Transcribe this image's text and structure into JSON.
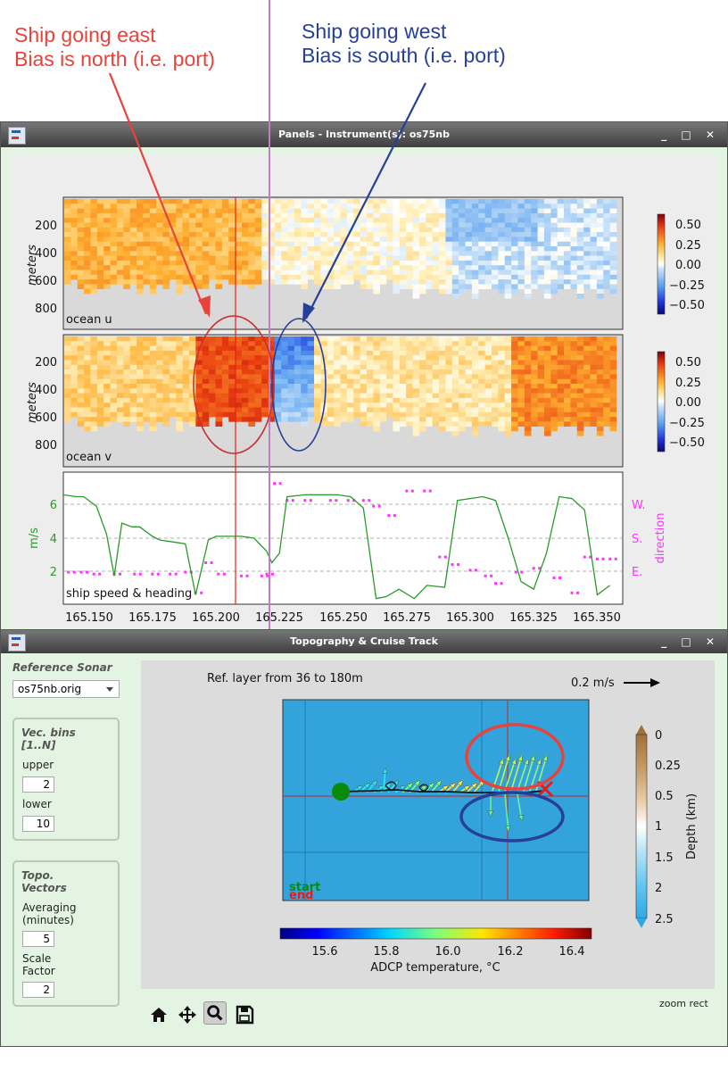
{
  "annotations": {
    "east_line1": "Ship going east",
    "east_line2": "Bias is north (i.e. port)",
    "west_line1": "Ship going west",
    "west_line2": "Bias is south (i.e. port)",
    "east_color": "#e8423a",
    "west_color": "#26409a"
  },
  "panels_window": {
    "title": "Panels - Instrument(s): os75nb",
    "buttons": [
      "_",
      "□",
      "✕"
    ]
  },
  "ocean_u": {
    "label": "ocean u",
    "ylabel": "meters",
    "yticks": [
      "200",
      "400",
      "600",
      "800"
    ],
    "cbar_ticks": [
      "0.50",
      "0.25",
      "0.00",
      "−0.25",
      "−0.50"
    ]
  },
  "ocean_v": {
    "label": "ocean v",
    "ylabel": "meters",
    "yticks": [
      "200",
      "400",
      "600",
      "800"
    ],
    "cbar_ticks": [
      "0.50",
      "0.25",
      "0.00",
      "−0.25",
      "−0.50"
    ]
  },
  "speed_panel": {
    "label": "ship speed & heading",
    "ylabel_left": "m/s",
    "ylabel_right": "direction",
    "yticks_left": [
      "6",
      "4",
      "2"
    ],
    "yticks_right": [
      "W.",
      "S.",
      "E."
    ],
    "xticks": [
      "165.150",
      "165.175",
      "165.200",
      "165.225",
      "165.250",
      "165.275",
      "165.300",
      "165.325",
      "165.350"
    ],
    "speed_color": "#2a9a2a",
    "heading_color": "#ff33ff"
  },
  "topo_window": {
    "title": "Topography & Cruise Track",
    "buttons": [
      "_",
      "□",
      "✕"
    ],
    "ref_sonar_label": "Reference Sonar",
    "ref_sonar_value": "os75nb.orig",
    "vec_group_title_1": "Vec. bins",
    "vec_group_title_2": "[1..N]",
    "upper_label": "upper",
    "upper_value": "2",
    "lower_label": "lower",
    "lower_value": "10",
    "topo_group_title_1": "Topo.",
    "topo_group_title_2": "Vectors",
    "avg_label_1": "Averaging",
    "avg_label_2": "(minutes)",
    "avg_value": "5",
    "scale_label_1": "Scale",
    "scale_label_2": "Factor",
    "scale_value": "2",
    "ref_layer": "Ref. layer from 36 to 180m",
    "scale_arrow": "0.2 m/s",
    "start": "start",
    "end": "end",
    "temp_ticks": [
      "15.6",
      "15.8",
      "16.0",
      "16.2",
      "16.4"
    ],
    "temp_label": "ADCP temperature, °C",
    "depth_ticks": [
      "0",
      "0.25",
      "0.5",
      "1",
      "1.5",
      "2",
      "2.5"
    ],
    "depth_label": "Depth (km)",
    "status": "zoom rect"
  },
  "chart_data": [
    {
      "type": "heatmap",
      "name": "ocean u",
      "x_range": [
        165.14,
        165.36
      ],
      "y_range": [
        0,
        1000
      ],
      "ylabel": "meters",
      "colorbar_range": [
        -0.5,
        0.5
      ]
    },
    {
      "type": "heatmap",
      "name": "ocean v",
      "x_range": [
        165.14,
        165.36
      ],
      "y_range": [
        0,
        1000
      ],
      "ylabel": "meters",
      "colorbar_range": [
        -0.5,
        0.5
      ]
    },
    {
      "type": "line",
      "name": "ship speed & heading",
      "x_range": [
        165.14,
        165.36
      ],
      "ylim": [
        0.5,
        7.5
      ],
      "series": [
        {
          "name": "speed",
          "x": [
            165.14,
            165.145,
            165.148,
            165.153,
            165.157,
            165.16,
            165.163,
            165.167,
            165.17,
            165.175,
            165.178,
            165.183,
            165.188,
            165.192,
            165.197,
            165.2,
            165.203,
            165.21,
            165.215,
            165.22,
            165.222,
            165.225,
            165.228,
            165.235,
            165.242,
            165.248,
            165.253,
            165.258,
            165.263,
            165.267,
            165.272,
            165.278,
            165.283,
            165.29,
            165.295,
            165.305,
            165.31,
            165.315,
            165.32,
            165.325,
            165.33,
            165.335,
            165.34,
            165.345,
            165.35,
            165.355
          ],
          "y": [
            6.3,
            6.2,
            6.2,
            5.7,
            4.2,
            2.0,
            4.8,
            4.6,
            4.6,
            4.1,
            3.9,
            3.8,
            3.7,
            1.0,
            3.9,
            4.1,
            4.1,
            4.1,
            4.0,
            3.3,
            2.7,
            3.2,
            6.2,
            6.3,
            6.3,
            6.3,
            6.2,
            5.6,
            0.8,
            0.9,
            1.3,
            0.8,
            1.5,
            1.4,
            6.0,
            6.2,
            6.0,
            4.0,
            1.7,
            1.3,
            3.2,
            6.2,
            6.1,
            5.5,
            1.0,
            1.5
          ]
        },
        {
          "name": "heading",
          "x": [
            165.142,
            165.147,
            165.152,
            165.16,
            165.168,
            165.175,
            165.182,
            165.188,
            165.192,
            165.196,
            165.201,
            165.21,
            165.218,
            165.22,
            165.223,
            165.228,
            165.235,
            165.245,
            165.252,
            165.258,
            165.262,
            165.268,
            165.275,
            165.282,
            165.288,
            165.293,
            165.3,
            165.306,
            165.31,
            165.318,
            165.325,
            165.333,
            165.34,
            165.345,
            165.35,
            165.355,
            165.36
          ],
          "y": [
            2.2,
            2.2,
            2.1,
            2.1,
            2.1,
            2.1,
            2.1,
            2.2,
            1.1,
            2.7,
            2.1,
            2.0,
            2.0,
            2.1,
            6.9,
            6.0,
            6.0,
            6.0,
            6.0,
            6.0,
            5.7,
            5.2,
            6.5,
            6.5,
            3.0,
            2.6,
            2.3,
            2.0,
            1.6,
            2.2,
            2.4,
            1.9,
            1.1,
            3.0,
            2.9,
            2.9,
            7.9
          ]
        }
      ]
    },
    {
      "type": "scatter",
      "name": "cruise track",
      "xlabel": "",
      "colorbar_label": "ADCP temperature, °C",
      "colorbar_range": [
        15.45,
        16.5
      ]
    }
  ]
}
